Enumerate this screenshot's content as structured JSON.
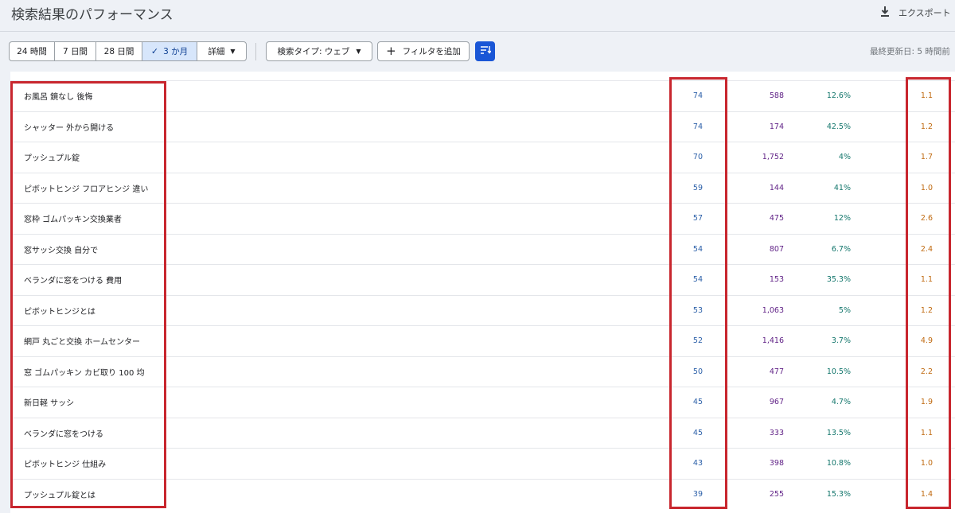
{
  "header": {
    "title": "検索結果のパフォーマンス",
    "export_label": "エクスポート"
  },
  "toolbar": {
    "ranges": [
      {
        "label": "24 時間",
        "selected": false
      },
      {
        "label": "7 日間",
        "selected": false
      },
      {
        "label": "28 日間",
        "selected": false
      },
      {
        "label": "3 か月",
        "selected": true
      },
      {
        "label": "詳細",
        "selected": false
      }
    ],
    "search_type_label": "検索タイプ: ウェブ",
    "add_filter_label": "フィルタを追加",
    "last_updated": "最終更新日: 5 時間前"
  },
  "colors": {
    "accent": "#1a56d6",
    "clicks": "#2b5fa8",
    "impressions": "#5e1f85",
    "ctr": "#13766c",
    "position": "#c06a10",
    "highlight": "#c8262e"
  },
  "rows": [
    {
      "query": "お風呂 鏡なし 後悔",
      "clicks": "74",
      "impressions": "588",
      "ctr": "12.6%",
      "position": "1.1"
    },
    {
      "query": "シャッター 外から開ける",
      "clicks": "74",
      "impressions": "174",
      "ctr": "42.5%",
      "position": "1.2"
    },
    {
      "query": "プッシュプル錠",
      "clicks": "70",
      "impressions": "1,752",
      "ctr": "4%",
      "position": "1.7"
    },
    {
      "query": "ピボットヒンジ フロアヒンジ 違い",
      "clicks": "59",
      "impressions": "144",
      "ctr": "41%",
      "position": "1.0"
    },
    {
      "query": "窓枠 ゴムパッキン交換業者",
      "clicks": "57",
      "impressions": "475",
      "ctr": "12%",
      "position": "2.6"
    },
    {
      "query": "窓サッシ交換 自分で",
      "clicks": "54",
      "impressions": "807",
      "ctr": "6.7%",
      "position": "2.4"
    },
    {
      "query": "ベランダに窓をつける 費用",
      "clicks": "54",
      "impressions": "153",
      "ctr": "35.3%",
      "position": "1.1"
    },
    {
      "query": "ピボットヒンジとは",
      "clicks": "53",
      "impressions": "1,063",
      "ctr": "5%",
      "position": "1.2"
    },
    {
      "query": "網戸 丸ごと交換 ホームセンター",
      "clicks": "52",
      "impressions": "1,416",
      "ctr": "3.7%",
      "position": "4.9"
    },
    {
      "query": "窓 ゴムパッキン カビ取り 100 均",
      "clicks": "50",
      "impressions": "477",
      "ctr": "10.5%",
      "position": "2.2"
    },
    {
      "query": "新日軽 サッシ",
      "clicks": "45",
      "impressions": "967",
      "ctr": "4.7%",
      "position": "1.9"
    },
    {
      "query": "ベランダに窓をつける",
      "clicks": "45",
      "impressions": "333",
      "ctr": "13.5%",
      "position": "1.1"
    },
    {
      "query": "ピボットヒンジ 仕組み",
      "clicks": "43",
      "impressions": "398",
      "ctr": "10.8%",
      "position": "1.0"
    },
    {
      "query": "プッシュプル錠とは",
      "clicks": "39",
      "impressions": "255",
      "ctr": "15.3%",
      "position": "1.4"
    }
  ]
}
